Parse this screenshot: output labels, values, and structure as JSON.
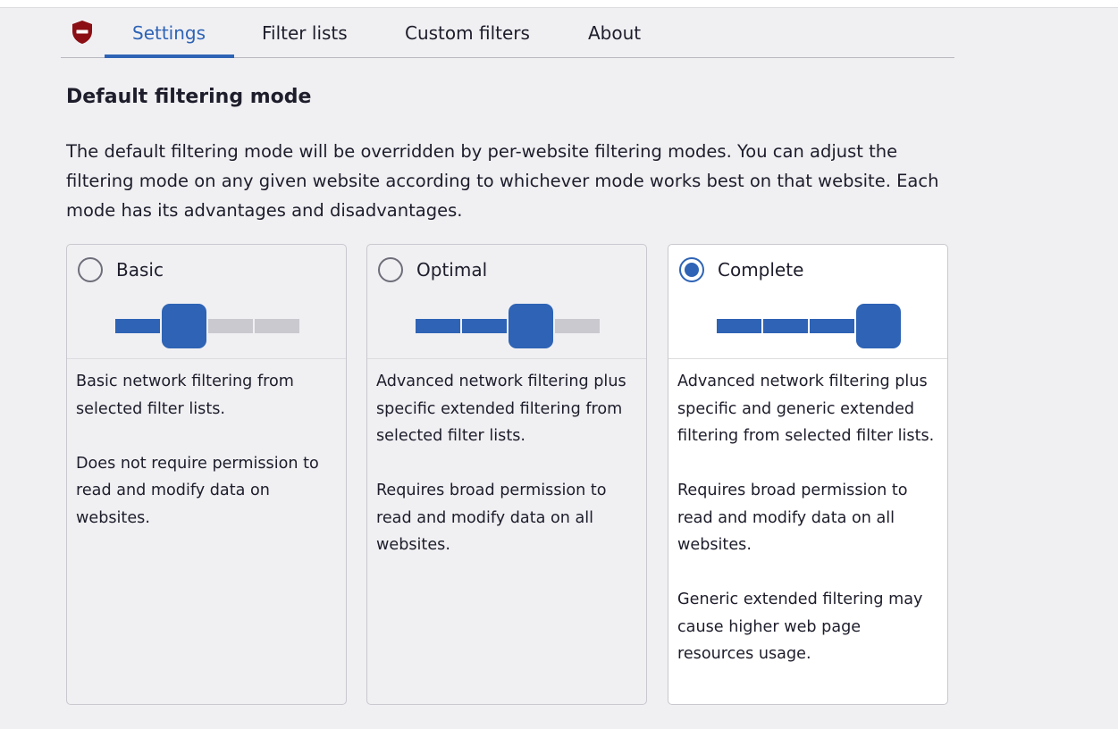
{
  "nav": {
    "logo": "ublock-shield-icon",
    "tabs": [
      {
        "label": "Settings",
        "active": true
      },
      {
        "label": "Filter lists",
        "active": false
      },
      {
        "label": "Custom filters",
        "active": false
      },
      {
        "label": "About",
        "active": false
      }
    ]
  },
  "main": {
    "heading": "Default filtering mode",
    "intro": "The default filtering mode will be overridden by per-website filtering modes. You can adjust the filtering mode on any given website according to whichever mode works best on that website. Each mode has its advantages and disadvantages.",
    "modes": [
      {
        "label": "Basic",
        "selected": false,
        "level": 1,
        "max_level": 3,
        "paragraphs": [
          "Basic network filtering from selected filter lists.",
          "Does not require permission to read and modify data on websites."
        ]
      },
      {
        "label": "Optimal",
        "selected": false,
        "level": 2,
        "max_level": 3,
        "paragraphs": [
          "Advanced network filtering plus specific extended filtering from selected filter lists.",
          "Requires broad permission to read and modify data on all websites."
        ]
      },
      {
        "label": "Complete",
        "selected": true,
        "level": 3,
        "max_level": 3,
        "paragraphs": [
          "Advanced network filtering plus specific and generic extended filtering from selected filter lists.",
          "Requires broad permission to read and modify data on all websites.",
          "Generic extended filtering may cause higher web page resources usage."
        ]
      }
    ]
  },
  "colors": {
    "accent": "#2e63b5",
    "logo_red": "#8b0f14",
    "background": "#f0f0f3"
  }
}
